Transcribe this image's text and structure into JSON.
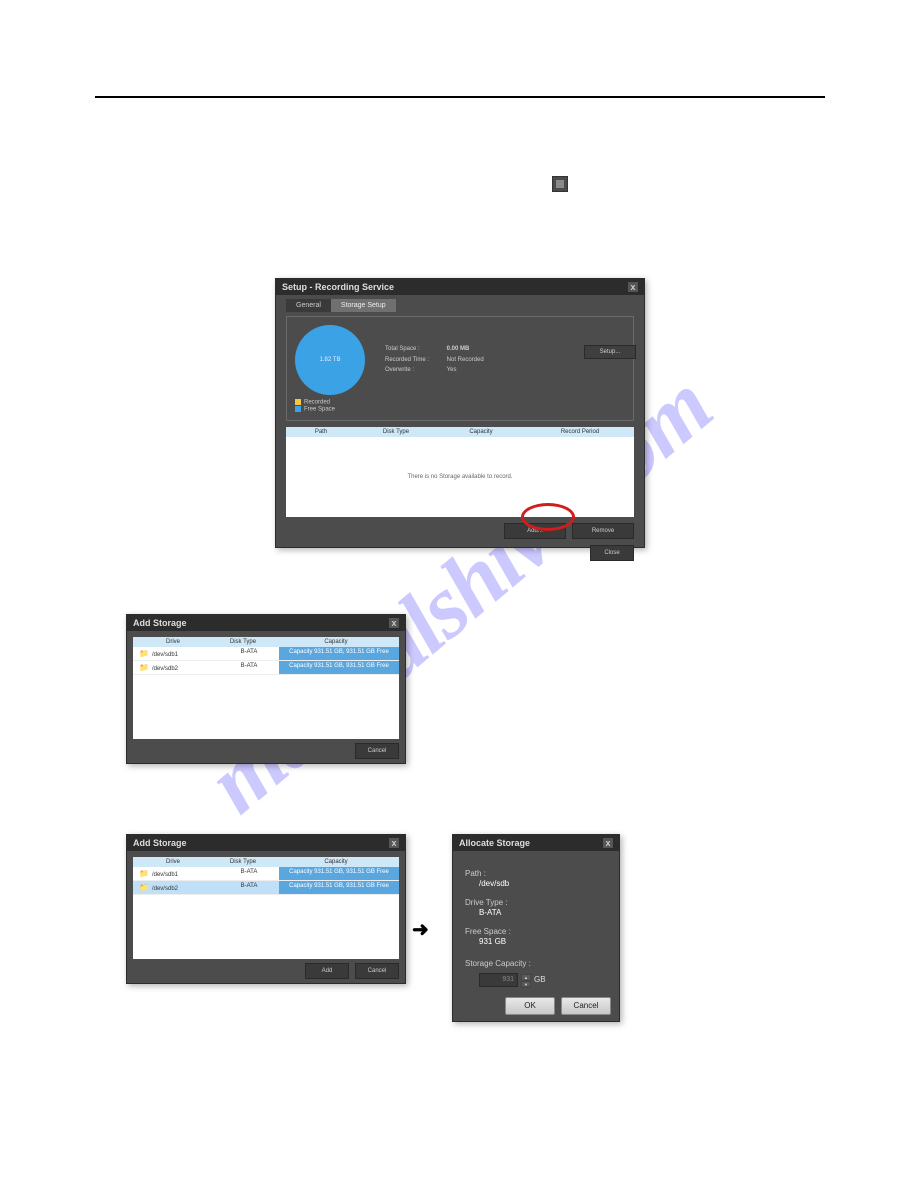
{
  "watermark": "manualshive.com",
  "setup_window": {
    "title": "Setup - Recording Service",
    "close": "x",
    "tabs": {
      "general": "General",
      "storage": "Storage Setup"
    },
    "pie_label": "1.82 TB",
    "info": {
      "total_label": "Total Space :",
      "total_value": "0.00 MB",
      "rectime_label": "Recorded Time :",
      "rectime_value": "Not Recorded",
      "overwrite_label": "Overwrite :",
      "overwrite_value": "Yes"
    },
    "legend": {
      "recorded": "Recorded",
      "free": "Free Space"
    },
    "setup_btn": "Setup...",
    "cols": {
      "path": "Path",
      "disktype": "Disk Type",
      "capacity": "Capacity",
      "recperiod": "Record Period"
    },
    "empty_msg": "There is no Storage available to record.",
    "add_btn": "Add...",
    "remove_btn": "Remove",
    "close_btn": "Close"
  },
  "add_storage1": {
    "title": "Add Storage",
    "close": "x",
    "cols": {
      "drive": "Drive",
      "disktype": "Disk Type",
      "capacity": "Capacity"
    },
    "rows": [
      {
        "drive": "/dev/sdb1",
        "type": "B-ATA",
        "capacity": "Capacity 931.51 GB, 931.51 GB Free"
      },
      {
        "drive": "/dev/sdb2",
        "type": "B-ATA",
        "capacity": "Capacity 931.51 GB, 931.51 GB Free"
      }
    ],
    "cancel": "Cancel"
  },
  "add_storage2": {
    "title": "Add Storage",
    "close": "x",
    "cols": {
      "drive": "Drive",
      "disktype": "Disk Type",
      "capacity": "Capacity"
    },
    "rows": [
      {
        "drive": "/dev/sdb1",
        "type": "B-ATA",
        "capacity": "Capacity 931.51 GB, 931.51 GB Free"
      },
      {
        "drive": "/dev/sdb2",
        "type": "B-ATA",
        "capacity": "Capacity 931.51 GB, 931.51 GB Free"
      }
    ],
    "add": "Add",
    "cancel": "Cancel"
  },
  "allocate": {
    "title": "Allocate Storage",
    "close": "x",
    "path_label": "Path :",
    "path_value": "/dev/sdb",
    "drive_label": "Drive Type :",
    "drive_value": "B-ATA",
    "free_label": "Free Space :",
    "free_value": "931 GB",
    "cap_label": "Storage Capacity :",
    "cap_value": "931",
    "cap_unit": "GB",
    "ok": "OK",
    "cancel": "Cancel"
  }
}
